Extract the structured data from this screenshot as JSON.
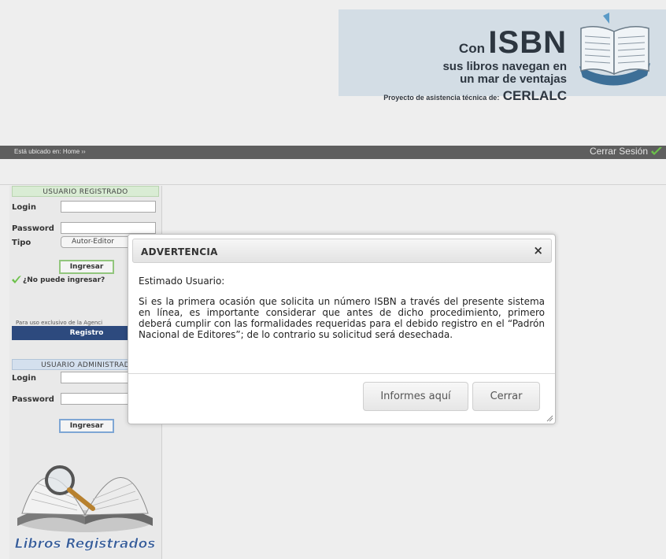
{
  "header": {
    "slogan_con": "Con",
    "slogan_isbn": "ISBN",
    "slogan_line1": "sus libros navegan en",
    "slogan_line2": "un mar de ventajas",
    "project_label": "Proyecto de asistencia técnica de:",
    "project_org": "CERLALC"
  },
  "breadcrumb": {
    "text": "Está ubicado en: Home ››",
    "logout_label": "Cerrar Sesión"
  },
  "sidebar": {
    "registered_heading": "USUARIO REGISTRADO",
    "login_label": "Login",
    "password_label": "Password",
    "tipo_label": "Tipo",
    "tipo_value": "Autor-Editor",
    "ingresar_label": "Ingresar",
    "no_ingresar_label": "¿No puede ingresar?",
    "exclusivo_text": "Para uso exclusivo de la Agenci",
    "registro_label": "Registro",
    "admin_heading": "USUARIO ADMINISTRAD",
    "admin_login_label": "Login",
    "admin_password_label": "Password",
    "admin_ingresar_label": "Ingresar",
    "libros_caption": "Libros Registrados"
  },
  "dialog": {
    "title": "ADVERTENCIA",
    "close_symbol": "×",
    "greeting": "Estimado Usuario:",
    "body": "Si es la primera ocasión que solicita un número ISBN a través del presente sistema en línea, es importante considerar que antes de dicho procedimiento, primero deberá cumplir con las formalidades requeridas para el debido registro en el “Padrón Nacional de Editores”; de lo contrario su solicitud será desechada.",
    "informes_label": "Informes aquí",
    "cerrar_label": "Cerrar"
  }
}
